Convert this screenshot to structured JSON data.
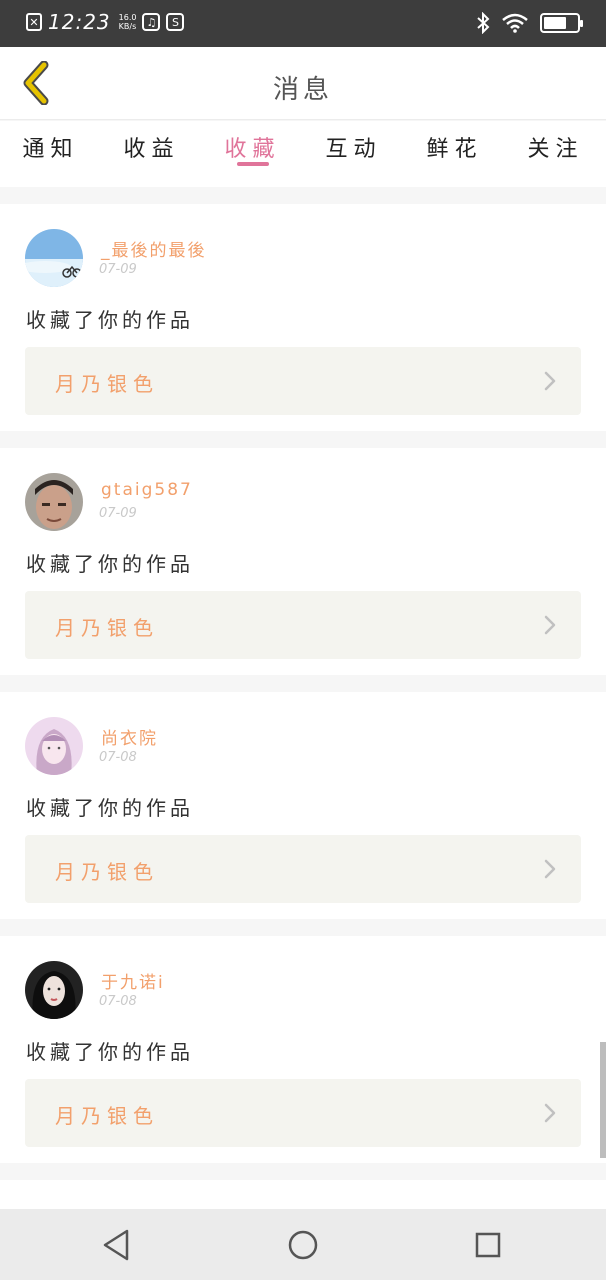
{
  "status_bar": {
    "time": "12:23",
    "speed_value": "16.0",
    "speed_unit": "KB/s",
    "notification_icon": "x-box-icon",
    "app_icons": [
      "music-icon",
      "s-app-icon"
    ],
    "right_icons": [
      "bluetooth-icon",
      "wifi-icon",
      "battery-icon"
    ],
    "battery_level": 0.7
  },
  "header": {
    "title": "消息",
    "back_icon": "chevron-left-icon",
    "back_color": "#e6c300"
  },
  "tabs": [
    {
      "label": "通知",
      "active": false
    },
    {
      "label": "收益",
      "active": false
    },
    {
      "label": "收藏",
      "active": true
    },
    {
      "label": "互动",
      "active": false
    },
    {
      "label": "鲜花",
      "active": false
    },
    {
      "label": "关注",
      "active": false
    }
  ],
  "colors": {
    "accent": "#e0749a",
    "name": "#f2a06c",
    "work_bg": "#f4f4ef"
  },
  "items": [
    {
      "username": "_最後的最後",
      "date": "07-09",
      "action": "收藏了你的作品",
      "work_title": "月乃银色",
      "avatar": "avatar-sky"
    },
    {
      "username": "gtaig587",
      "date": "07-09",
      "action": "收藏了你的作品",
      "work_title": "月乃银色",
      "avatar": "avatar-man"
    },
    {
      "username": "尚衣院",
      "date": "07-08",
      "action": "收藏了你的作品",
      "work_title": "月乃银色",
      "avatar": "avatar-girl-pink"
    },
    {
      "username": "于九诺i",
      "date": "07-08",
      "action": "收藏了你的作品",
      "work_title": "月乃银色",
      "avatar": "avatar-girl-dark"
    }
  ],
  "navbar": {
    "icons": [
      "back-triangle-icon",
      "home-circle-icon",
      "recent-square-icon"
    ]
  }
}
